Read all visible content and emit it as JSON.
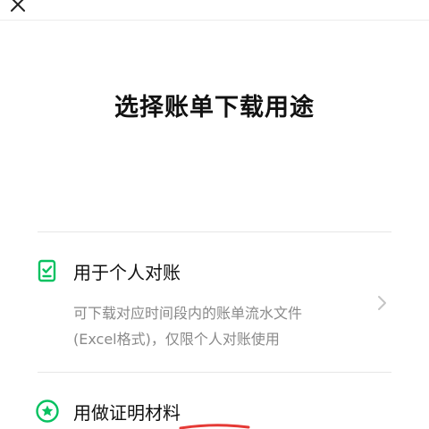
{
  "header": {
    "close_icon": "close-icon"
  },
  "page": {
    "title": "选择账单下载用途"
  },
  "options": [
    {
      "icon": "document-check-icon",
      "title": "用于个人对账",
      "description_line1": "可下载对应时间段内的账单流水文件",
      "description_line2": "(Excel格式)，仅限个人对账使用",
      "chevron_icon": "chevron-right-icon"
    },
    {
      "icon": "star-badge-icon",
      "title": "用做证明材料"
    }
  ],
  "colors": {
    "accent": "#07c160",
    "annotation": "#e53935",
    "muted_text": "#8a8a8a",
    "divider": "#e6e6e6"
  }
}
